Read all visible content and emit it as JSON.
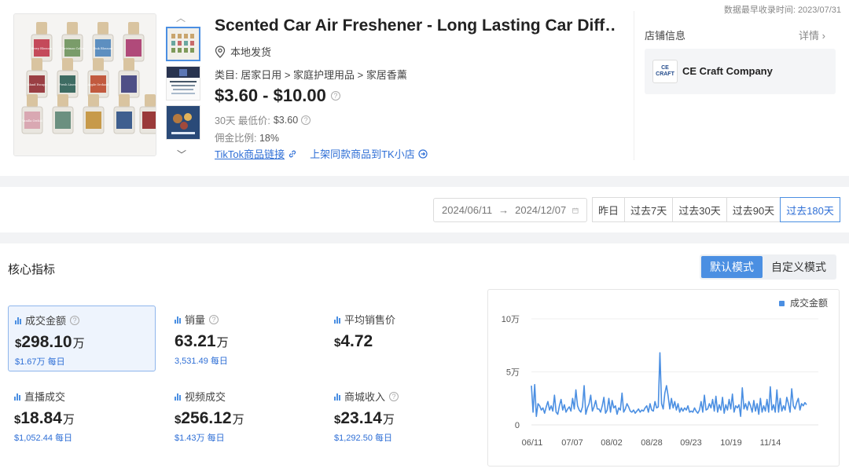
{
  "header": {
    "record_time": "数据最早收录时间: 2023/07/31"
  },
  "product": {
    "title": "Scented Car Air Freshener - Long Lasting Car Diff…",
    "shipping": "本地发货",
    "category": "类目: 居家日用 > 家庭护理用品 > 家居香薰",
    "price_range": "$3.60 - $10.00",
    "low30_label": "30天 最低价:",
    "low30_value": "$3.60",
    "commission_label": "佣金比例:",
    "commission_value": "18%",
    "link_tiktok": "TikTok商品链接",
    "link_list": "上架同款商品到TK小店",
    "image_labels": [
      "Berry Blossom",
      "Christmas Cabin",
      "Pink Blossom",
      "Island Escape",
      "Fresh Linen",
      "Apple Orchard",
      "Vanilla Orchid"
    ]
  },
  "shop": {
    "section_title": "店铺信息",
    "detail_label": "详情",
    "name": "CE Craft Company",
    "logo_text": "CE CRAFT"
  },
  "filters": {
    "date_start": "2024/06/11",
    "date_end": "2024/12/07",
    "ranges": [
      "昨日",
      "过去7天",
      "过去30天",
      "过去90天",
      "过去180天"
    ],
    "active_range": 4
  },
  "metrics": {
    "section_title": "核心指标",
    "modes": [
      "默认模式",
      "自定义模式"
    ],
    "items": [
      {
        "label": "成交金额",
        "currency": "$",
        "value": "298.10",
        "unit": "万",
        "sub": "$1.67万 每日",
        "help": true
      },
      {
        "label": "销量",
        "currency": "",
        "value": "63.21",
        "unit": "万",
        "sub": "3,531.49 每日",
        "help": true
      },
      {
        "label": "平均销售价",
        "currency": "$",
        "value": "4.72",
        "unit": "",
        "sub": "",
        "help": false
      },
      {
        "label": "直播成交",
        "currency": "$",
        "value": "18.84",
        "unit": "万",
        "sub": "$1,052.44 每日",
        "help": false
      },
      {
        "label": "视频成交",
        "currency": "$",
        "value": "256.12",
        "unit": "万",
        "sub": "$1.43万 每日",
        "help": false
      },
      {
        "label": "商城收入",
        "currency": "$",
        "value": "23.14",
        "unit": "万",
        "sub": "$1,292.50 每日",
        "help": true
      }
    ]
  },
  "colors": {
    "accent": "#4b8fe2",
    "link": "#2f6fd6"
  },
  "chart_data": {
    "type": "line",
    "legend": [
      "成交金额"
    ],
    "legend_position": "top-right",
    "y_ticks": [
      "0",
      "5万",
      "10万"
    ],
    "ylim": [
      0,
      100000
    ],
    "x_ticks": [
      "06/11",
      "07/07",
      "08/02",
      "08/28",
      "09/23",
      "10/19",
      "11/14"
    ],
    "series": [
      {
        "name": "成交金额",
        "values": [
          37000,
          12000,
          38000,
          8000,
          20000,
          18000,
          14000,
          16000,
          11000,
          17000,
          22000,
          14000,
          18000,
          13000,
          28000,
          12000,
          10000,
          18000,
          24000,
          14000,
          19000,
          12000,
          15000,
          17000,
          13000,
          25000,
          15000,
          33000,
          18000,
          14000,
          12000,
          17000,
          37000,
          10000,
          16000,
          20000,
          28000,
          13000,
          17000,
          23000,
          15000,
          15000,
          12000,
          18000,
          26000,
          11000,
          14000,
          25000,
          12000,
          23000,
          16000,
          18000,
          10000,
          16000,
          14000,
          30000,
          12000,
          15000,
          20000,
          17000,
          13000,
          12000,
          14000,
          11000,
          13000,
          15000,
          12000,
          14000,
          13000,
          16000,
          18000,
          12000,
          20000,
          14000,
          13000,
          22000,
          16000,
          17000,
          68000,
          20000,
          15000,
          30000,
          37000,
          27000,
          15000,
          25000,
          16000,
          22000,
          14000,
          20000,
          12000,
          16000,
          13000,
          16000,
          14000,
          18000,
          12000,
          13000,
          12000,
          16000,
          13000,
          11000,
          14000,
          22000,
          12000,
          28000,
          14000,
          15000,
          20000,
          16000,
          24000,
          13000,
          27000,
          12000,
          19000,
          14000,
          26000,
          11000,
          19000,
          14000,
          24000,
          15000,
          29000,
          12000,
          18000,
          16000,
          19000,
          8000,
          35000,
          15000,
          20000,
          14000,
          22000,
          18000,
          12000,
          23000,
          13000,
          20000,
          10000,
          25000,
          12000,
          18000,
          13000,
          24000,
          12000,
          36000,
          14000,
          19000,
          12000,
          33000,
          12000,
          25000,
          13000,
          18000,
          14000,
          26000,
          20000,
          12000,
          34000,
          18000,
          15000,
          21000,
          25000,
          14000,
          20000,
          18000,
          21000,
          19000
        ]
      }
    ]
  }
}
